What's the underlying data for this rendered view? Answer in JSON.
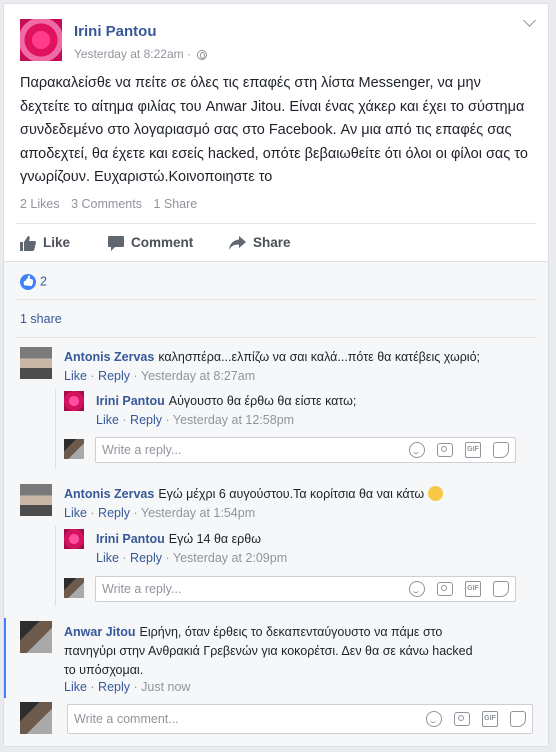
{
  "post": {
    "author": "Irini Pantou",
    "timestamp": "Yesterday at 8:22am",
    "text": "Παρακαλείσθε να πείτε σε όλες τις επαφές στη λίστα Messenger, να μην δεχτείτε το αίτημα φιλίας του Anwar Jitou. Είναι ένας χάκερ και έχει το σύστημα συνδεδεμένο στο λογαριασμό σας στο Facebook. Αν μια από τις επαφές σας αποδεχτεί, θα έχετε και εσείς hacked, οπότε βεβαιωθείτε ότι όλοι οι φίλοι σας το γνωρίζουν. Ευχαριστώ.Κοινοποιηστε το",
    "counts": {
      "likes": "2 Likes",
      "comments": "3 Comments",
      "shares": "1 Share"
    },
    "actions": {
      "like": "Like",
      "comment": "Comment",
      "share": "Share"
    },
    "reaction_count": "2",
    "share_link": "1 share"
  },
  "comments": [
    {
      "author": "Antonis Zervas",
      "text": "καλησπέρα...ελπίζω να σαι καλά...πότε θα κατέβεις χωριό;",
      "like": "Like",
      "reply": "Reply",
      "time": "Yesterday at 8:27am"
    },
    {
      "author": "Irini Pantou",
      "text": "Αύγουστο θα έρθω θα είστε κατω;",
      "like": "Like",
      "reply": "Reply",
      "time": "Yesterday at 12:58pm"
    },
    {
      "author": "Antonis Zervas",
      "text": "Εγώ μέχρι 6 αυγούστου.Τα κορίτσια θα ναι κάτω",
      "like": "Like",
      "reply": "Reply",
      "time": "Yesterday at 1:54pm"
    },
    {
      "author": "Irini Pantou",
      "text": "Εγώ 14 θα ερθω",
      "like": "Like",
      "reply": "Reply",
      "time": "Yesterday at 2:09pm"
    },
    {
      "author": "Anwar Jitou",
      "text": "Ειρήνη, όταν έρθεις το δεκαπενταύγουστο να πάμε στο πανηγύρι στην Ανθρακιά Γρεβενών για κοκορέτσι. Δεν θα σε κάνω hacked το υπόσχομαι.",
      "like": "Like",
      "reply": "Reply",
      "time": "Just now"
    }
  ],
  "reply_placeholder": "Write a reply...",
  "comment_placeholder": "Write a comment...",
  "gif_label": "GIF",
  "icons": [
    "globe-icon",
    "chevron-down-icon",
    "like-icon",
    "comment-icon",
    "share-icon",
    "emoji-icon",
    "camera-icon",
    "gif-icon",
    "sticker-icon"
  ],
  "colors": {
    "link": "#365899",
    "meta": "#90949c",
    "reaction_blue": "#4080ff"
  }
}
